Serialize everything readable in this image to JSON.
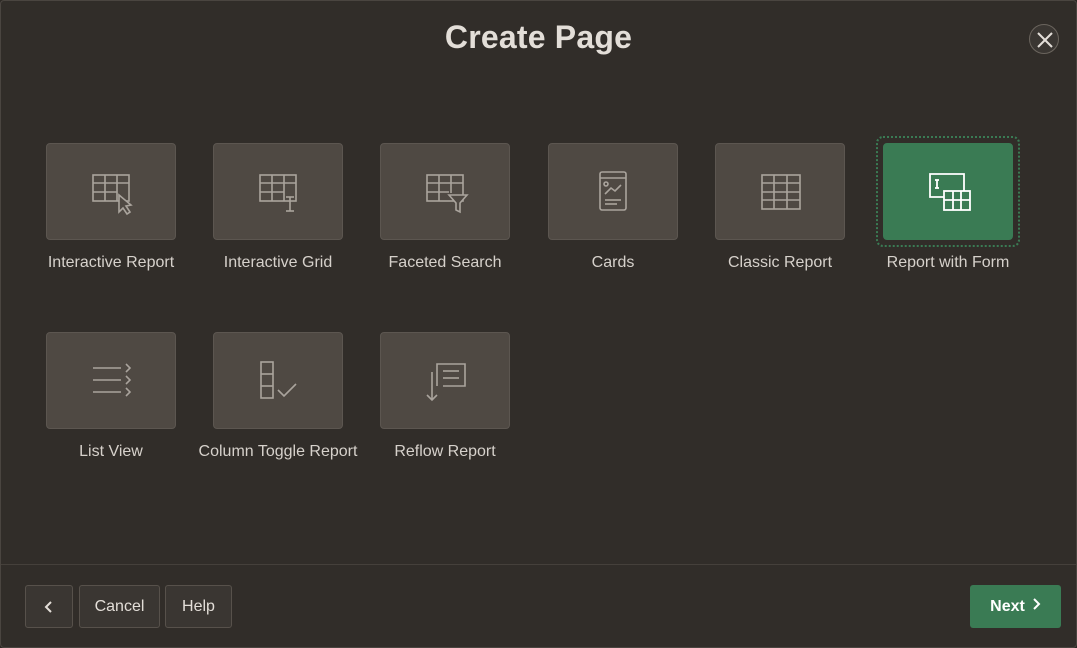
{
  "dialog": {
    "title": "Create Page"
  },
  "tiles": [
    {
      "label": "Interactive Report",
      "icon": "interactive-report-icon"
    },
    {
      "label": "Interactive Grid",
      "icon": "interactive-grid-icon"
    },
    {
      "label": "Faceted Search",
      "icon": "faceted-search-icon"
    },
    {
      "label": "Cards",
      "icon": "cards-icon"
    },
    {
      "label": "Classic Report",
      "icon": "classic-report-icon"
    },
    {
      "label": "Report with Form",
      "icon": "report-with-form-icon",
      "selected": true
    },
    {
      "label": "List View",
      "icon": "list-view-icon"
    },
    {
      "label": "Column Toggle Report",
      "icon": "column-toggle-report-icon"
    },
    {
      "label": "Reflow Report",
      "icon": "reflow-report-icon"
    }
  ],
  "footer": {
    "back_icon": "chevron-left-icon",
    "cancel_label": "Cancel",
    "help_label": "Help",
    "next_label": "Next"
  },
  "colors": {
    "background": "#312d29",
    "tile": "#4f4943",
    "accent": "#3a7b54"
  }
}
